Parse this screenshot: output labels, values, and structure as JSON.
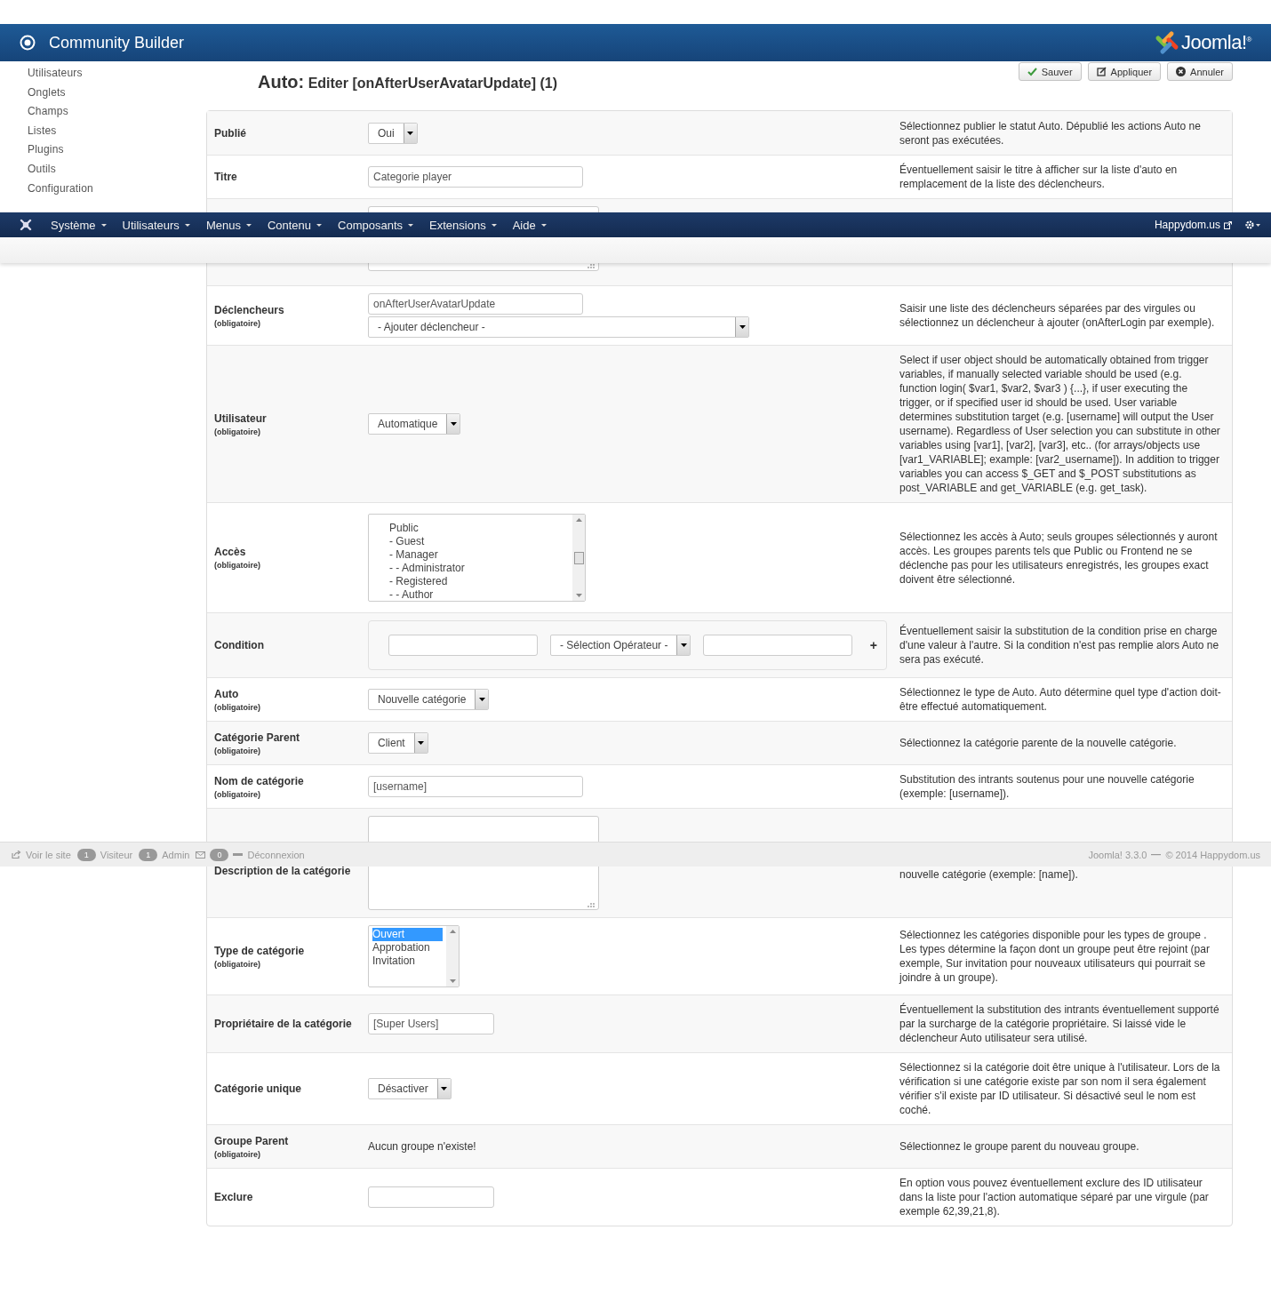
{
  "header": {
    "title": "Community Builder",
    "logo_text": "Joomla!$^{®}$"
  },
  "sidebar": {
    "items": [
      "Utilisateurs",
      "Onglets",
      "Champs",
      "Listes",
      "Plugins",
      "Outils",
      "Configuration"
    ]
  },
  "page_title": {
    "prefix": "Auto:",
    "text": "Editer [onAfterUserAvatarUpdate] (1)"
  },
  "toolbar": {
    "buttons": [
      {
        "kind": "save",
        "label": "Sauver"
      },
      {
        "kind": "apply",
        "label": "Appliquer"
      },
      {
        "kind": "cancel",
        "label": "Annuler"
      }
    ]
  },
  "form": {
    "rows": [
      {
        "label": "Publié",
        "kind": "select",
        "value": "Oui",
        "description": "Sélectionnez publier le statut Auto. Dépublié les actions Auto ne seront pas exécutées."
      },
      {
        "label": "Titre",
        "kind": "input",
        "value": "Categorie player",
        "description": "Éventuellement saisir le titre à afficher sur la liste d'auto en remplacement de la liste des déclencheurs."
      },
      {
        "kind": "textarea"
      },
      {
        "label": "Déclencheurs",
        "note": "(obligatoire)",
        "kind": "trigger",
        "value": "onAfterUserAvatarUpdate",
        "select": "- Ajouter déclencheur -",
        "description": "Saisir une liste des déclencheurs séparées par des virgules ou sélectionnez un déclencheur à ajouter (onAfterLogin par exemple)."
      },
      {
        "label": "Utilisateur",
        "note": "(obligatoire)",
        "kind": "select",
        "value": "Automatique",
        "description": "Select if user object should be automatically obtained from trigger variables, if manually selected variable should be used (e.g. function login( $var1, $var2, $var3 ) {...}, if user executing the trigger, or if specified user id should be used. User variable determines substitution target (e.g. [username] will output the User username). Regardless of User selection you can substitute in other variables using [var1], [var2], [var3], etc.. (for arrays/objects use [var1_VARIABLE]; example: [var2_username]). In addition to trigger variables you can access $_GET and $_POST substitutions as post_VARIABLE and get_VARIABLE (e.g. get_task)."
      },
      {
        "label": "Accès",
        "note": "(obligatoire)",
        "kind": "listbox",
        "items": [
          {
            "label": "Public",
            "selected": false
          },
          {
            "label": "- Guest",
            "selected": false
          },
          {
            "label": "- Manager",
            "selected": false
          },
          {
            "label": "- - Administrator",
            "selected": false
          },
          {
            "label": "- Registered",
            "selected": false
          },
          {
            "label": "- - Author",
            "selected": false
          }
        ],
        "description": "Sélectionnez les accès à Auto; seuls groupes sélectionnés y auront accès. Les groupes parents tels que Public ou Frontend ne se déclenche pas pour les utilisateurs enregistrés, les groupes exact doivent être sélectionné."
      },
      {
        "label": "Condition",
        "kind": "condition",
        "operator": "- Sélection Opérateur -",
        "add": "+",
        "description": "Éventuellement saisir la substitution de la condition prise en charge d'une valeur à l'autre. Si la condition n'est pas remplie alors Auto ne sera pas exécuté."
      },
      {
        "label": "Auto",
        "note": "(obligatoire)",
        "kind": "select",
        "value": "Nouvelle catégorie",
        "description": "Sélectionnez le type de Auto. Auto détermine quel type d'action doit-être effectué automatiquement."
      },
      {
        "label": "Catégorie Parent",
        "note": "(obligatoire)",
        "kind": "select",
        "value": "Client",
        "description": "Sélectionnez la catégorie parente de la nouvelle catégorie."
      },
      {
        "label": "Nom de catégorie",
        "note": "(obligatoire)",
        "kind": "input",
        "value": "[username]",
        "description": "Substitution des intrants soutenus pour une nouvelle catégorie (exemple: [username])."
      },
      {
        "label": "Description de la catégorie",
        "kind": "textarea",
        "description": "nouvelle catégorie (exemple: [name])."
      },
      {
        "label": "Type de catégorie",
        "note": "(obligatoire)",
        "kind": "listbox",
        "items": [
          {
            "label": "Ouvert",
            "selected": true
          },
          {
            "label": "Approbation",
            "selected": false
          },
          {
            "label": "Invitation",
            "selected": false
          }
        ],
        "description": "Sélectionnez les catégories disponible pour les types de groupe . Les types détermine la façon dont un groupe peut être rejoint (par exemple, Sur invitation pour nouveaux utilisateurs qui pourrait se joindre à un groupe)."
      },
      {
        "label": "Propriétaire de la catégorie",
        "kind": "short_input",
        "value": "[Super Users]",
        "description": "Éventuellement la substitution des intrants éventuellement supporté par la surcharge de la catégorie propriétaire. Si laissé vide le déclencheur Auto utilisateur sera utilisé."
      },
      {
        "label": "Catégorie unique",
        "kind": "select",
        "value": "Désactiver",
        "description": "Sélectionnez si la catégorie doit être unique à l'utilisateur. Lors de la vérification si une catégorie existe par son nom il sera également vérifier s'il existe par ID utilisateur. Si désactivé seul le nom est coché."
      },
      {
        "label": "Groupe Parent",
        "note": "(obligatoire)",
        "kind": "text",
        "value": "Aucun groupe n'existe!",
        "description": "Sélectionnez le groupe parent du nouveau groupe."
      },
      {
        "label": "Exclure",
        "kind": "short_input",
        "description": "En option vous pouvez éventuellement exclure des ID utilisateur dans la liste pour l'action automatique séparé par une virgule (par exemple 62,39,21,8)."
      }
    ]
  },
  "admin_menu": {
    "items": [
      "Système",
      "Utilisateurs",
      "Menus",
      "Contenu",
      "Composants",
      "Extensions",
      "Aide"
    ],
    "site_link": "Happydom.us"
  },
  "status_bar": {
    "items": [
      {
        "kind": "link",
        "label": "Voir le site"
      },
      {
        "kind": "count",
        "count": "1",
        "label": "Visiteur"
      },
      {
        "kind": "count",
        "count": "1",
        "label": "Admin"
      },
      {
        "kind": "messages",
        "count": "0"
      },
      {
        "kind": "logout",
        "label": "Déconnexion"
      }
    ],
    "version": "Joomla! 3.3.0",
    "copyright": "© 2014 Happydom.us"
  }
}
